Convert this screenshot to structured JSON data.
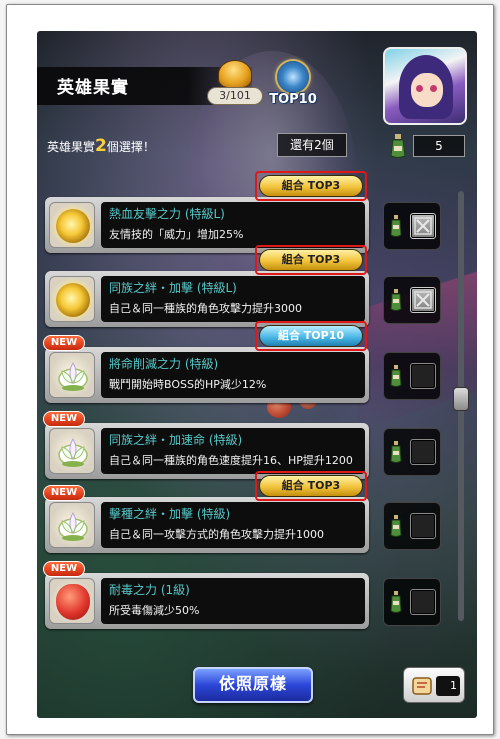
{
  "header": {
    "title": "英雄果實",
    "fruit_count": "3/101",
    "top10_label": "TOP10"
  },
  "selection": {
    "hint_prefix": "英雄果實",
    "hint_number": "2",
    "hint_suffix": "個選擇！",
    "remaining": "還有2個",
    "potion_count": "5"
  },
  "items": [
    {
      "name": "熱血友擊之力 (特級L)",
      "desc": "友情技的「威力」增加25%",
      "badge": "組合 TOP3",
      "badge_style": "gold",
      "new": false,
      "icon": "gold-fruit-icon",
      "checkbox": "disabled"
    },
    {
      "name": "同族之絆・加擊 (特級L)",
      "desc": "自己＆同一種族的角色攻擊力提升3000",
      "badge": "組合 TOP3",
      "badge_style": "gold",
      "new": false,
      "icon": "gold-fruit-icon",
      "checkbox": "disabled"
    },
    {
      "name": "將命削減之力 (特級)",
      "desc": "戰鬥開始時BOSS的HP減少12%",
      "badge": "組合 TOP10",
      "badge_style": "blue",
      "new": true,
      "icon": "lotus-fruit-icon",
      "checkbox": "empty"
    },
    {
      "name": "同族之絆・加速命 (特級)",
      "desc": "自己＆同一種族的角色速度提升16、HP提升1200",
      "badge": "",
      "badge_style": "",
      "new": true,
      "icon": "lotus-fruit-icon",
      "checkbox": "empty"
    },
    {
      "name": "擊種之絆・加擊 (特級)",
      "desc": "自己＆同一攻擊方式的角色攻擊力提升1000",
      "badge": "組合 TOP3",
      "badge_style": "gold",
      "new": true,
      "icon": "lotus-fruit-icon",
      "checkbox": "empty"
    },
    {
      "name": "耐毒之力 (1級)",
      "desc": "所受毒傷減少50%",
      "badge": "",
      "badge_style": "",
      "new": true,
      "icon": "red-fruit-icon",
      "checkbox": "empty"
    }
  ],
  "new_label": "NEW",
  "footer": {
    "reset_label": "依照原樣",
    "scroll_qty": "1"
  },
  "colors": {
    "skill_name": "#58c9c9",
    "highlight_number": "#ffd23a",
    "badge_outline": "#e01818"
  }
}
